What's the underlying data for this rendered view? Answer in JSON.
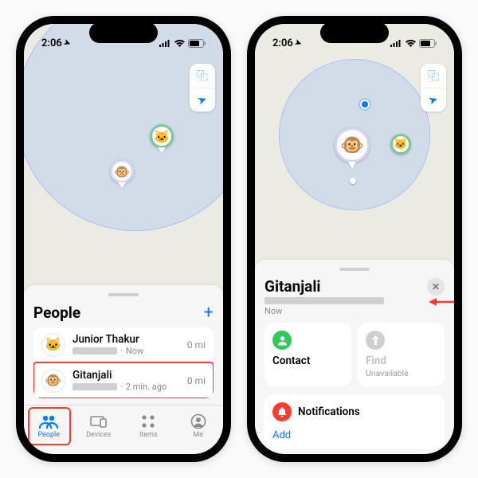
{
  "status": {
    "time": "2:06",
    "location_glyph": "➤"
  },
  "map_controls": {
    "style_icon": "⿻",
    "locate_icon": "➤"
  },
  "left": {
    "panel_title": "People",
    "add_glyph": "+",
    "people": [
      {
        "name": "Junior Thakur",
        "meta": "Now",
        "distance": "0 mi",
        "avatar": "🐱"
      },
      {
        "name": "Gitanjali",
        "meta": "2 min. ago",
        "distance": "0 mi",
        "avatar": "🐵"
      }
    ],
    "tabs": [
      {
        "id": "people",
        "label": "People"
      },
      {
        "id": "devices",
        "label": "Devices"
      },
      {
        "id": "items",
        "label": "Items"
      },
      {
        "id": "me",
        "label": "Me"
      }
    ]
  },
  "right": {
    "title": "Gitanjali",
    "subtitle": "Now",
    "close_glyph": "✕",
    "cards": {
      "contact": {
        "label": "Contact",
        "icon_name": "person-icon"
      },
      "find": {
        "label": "Find",
        "sub": "Unavailable",
        "icon_name": "arrow-up-icon"
      }
    },
    "notifications": {
      "label": "Notifications",
      "add_label": "Add"
    }
  }
}
